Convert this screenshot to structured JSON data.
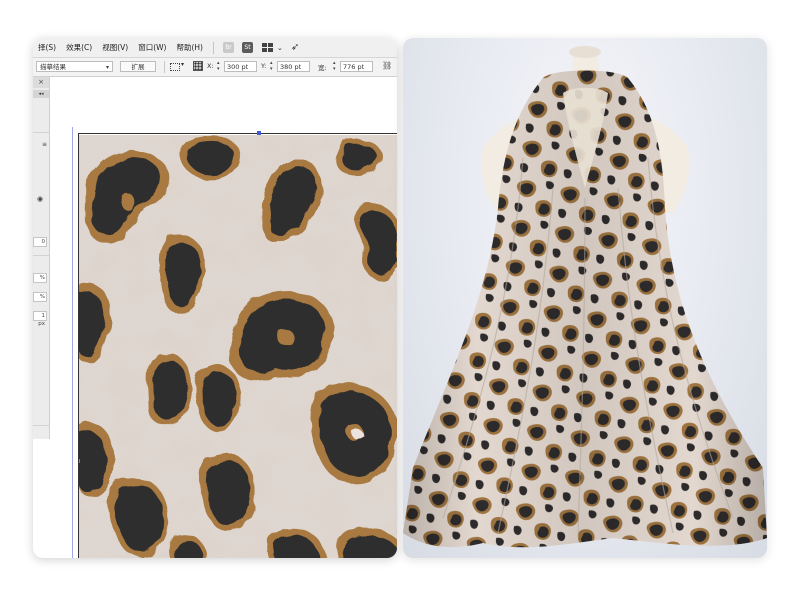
{
  "menubar": {
    "items": [
      "择(S)",
      "效果(C)",
      "视图(V)",
      "窗口(W)",
      "帮助(H)"
    ],
    "app_icons": [
      "Br",
      "St"
    ],
    "layout_icon": "workspace-grid-icon",
    "publish_icon": "rocket-icon"
  },
  "control_bar": {
    "dropdown_value": "描摹结果",
    "expand_label": "扩展",
    "x_label": "X:",
    "x_value": "300 pt",
    "y_label": "Y:",
    "y_value": "380 pt",
    "w_label": "宽:",
    "w_value": "776 pt"
  },
  "sidebar": {
    "close": "×",
    "collapse": "◂◂",
    "menu": "≡",
    "values": [
      "0",
      "%",
      "%",
      "1 px"
    ]
  },
  "colors": {
    "leopard_base": "#ddd3cb",
    "leopard_rosette_outer": "#a8793f",
    "leopard_rosette_inner": "#2f2d2e",
    "guide_blue": "#6f7fe6",
    "photo_bg": "#e6e9f0"
  }
}
